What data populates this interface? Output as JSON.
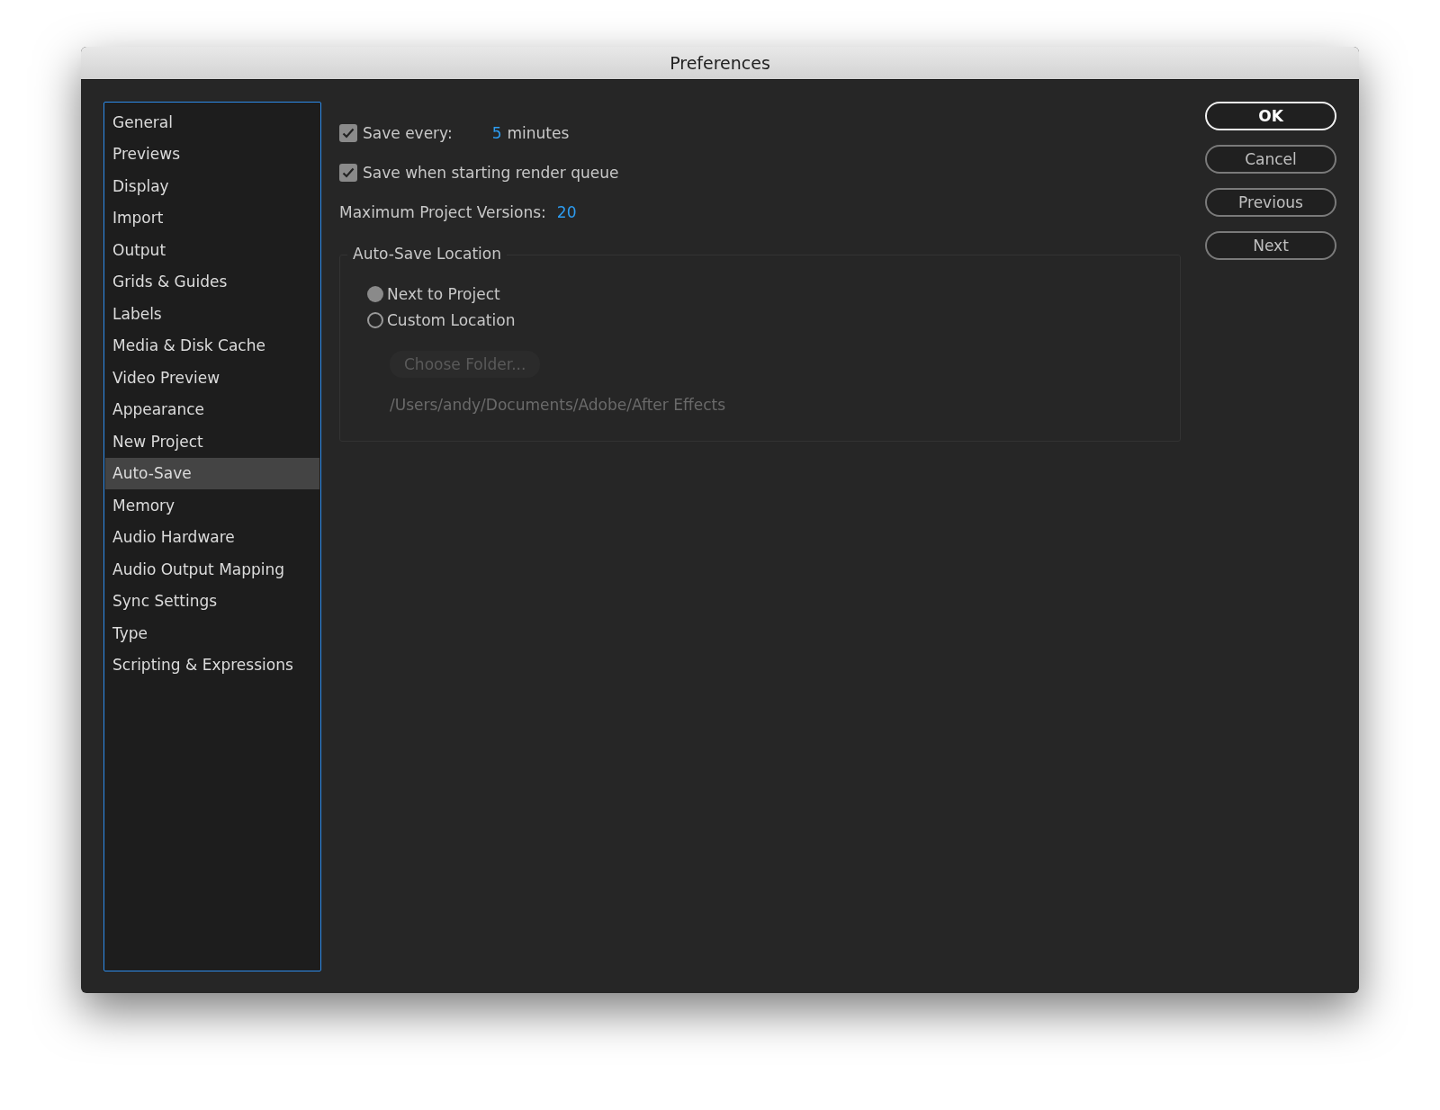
{
  "window": {
    "title": "Preferences"
  },
  "sidebar": {
    "items": [
      {
        "label": "General",
        "selected": false
      },
      {
        "label": "Previews",
        "selected": false
      },
      {
        "label": "Display",
        "selected": false
      },
      {
        "label": "Import",
        "selected": false
      },
      {
        "label": "Output",
        "selected": false
      },
      {
        "label": "Grids & Guides",
        "selected": false
      },
      {
        "label": "Labels",
        "selected": false
      },
      {
        "label": "Media & Disk Cache",
        "selected": false
      },
      {
        "label": "Video Preview",
        "selected": false
      },
      {
        "label": "Appearance",
        "selected": false
      },
      {
        "label": "New Project",
        "selected": false
      },
      {
        "label": "Auto-Save",
        "selected": true
      },
      {
        "label": "Memory",
        "selected": false
      },
      {
        "label": "Audio Hardware",
        "selected": false
      },
      {
        "label": "Audio Output Mapping",
        "selected": false
      },
      {
        "label": "Sync Settings",
        "selected": false
      },
      {
        "label": "Type",
        "selected": false
      },
      {
        "label": "Scripting & Expressions",
        "selected": false
      }
    ]
  },
  "save_every": {
    "label": "Save every:",
    "checked": true,
    "value": "5",
    "unit": "minutes"
  },
  "save_on_render": {
    "label": "Save when starting render queue",
    "checked": true
  },
  "max_versions": {
    "label": "Maximum Project Versions:",
    "value": "20"
  },
  "location": {
    "title": "Auto-Save Location",
    "options": [
      {
        "label": "Next to Project",
        "selected": true
      },
      {
        "label": "Custom Location",
        "selected": false
      }
    ],
    "choose_button": {
      "label": "Choose Folder...",
      "disabled": true
    },
    "path": "/Users/andy/Documents/Adobe/After Effects"
  },
  "buttons": [
    {
      "label": "OK",
      "default": true
    },
    {
      "label": "Cancel",
      "default": false
    },
    {
      "label": "Previous",
      "default": false
    },
    {
      "label": "Next",
      "default": false
    }
  ]
}
